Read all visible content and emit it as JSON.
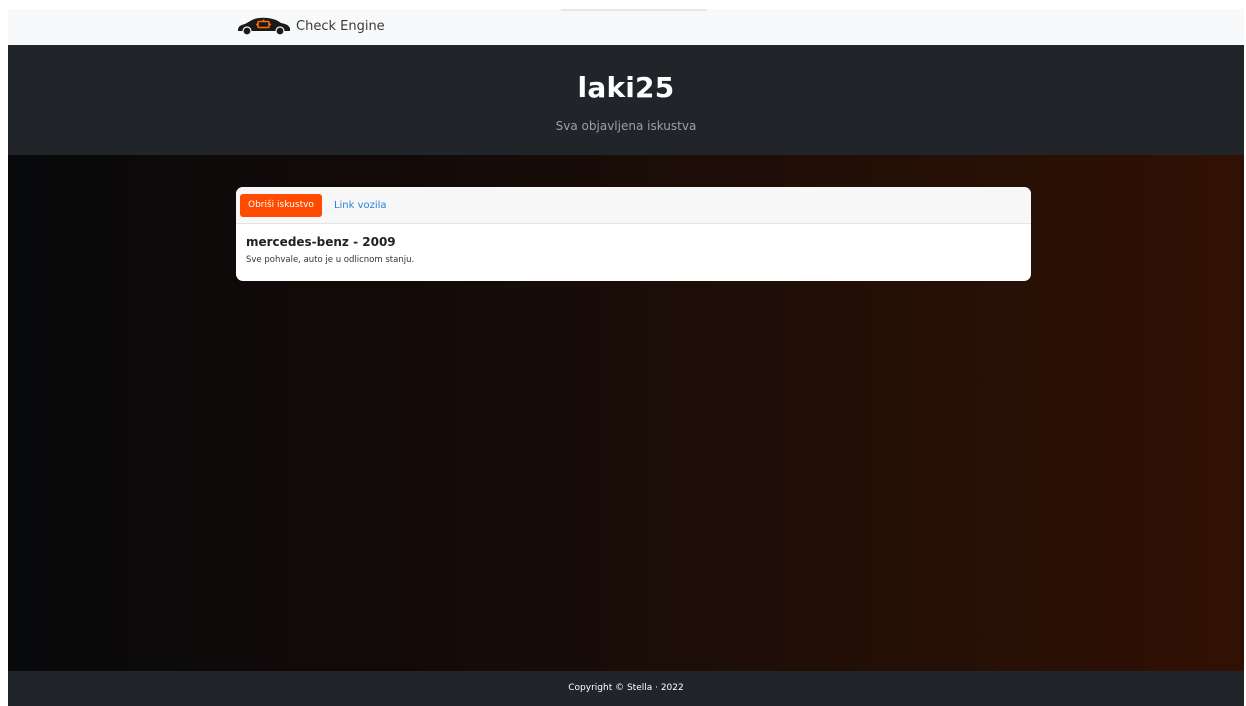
{
  "navbar": {
    "brand_icon": "car-check-engine-icon",
    "brand_text": "Check Engine"
  },
  "header": {
    "title": "laki25",
    "subtitle": "Sva objavljena iskustva"
  },
  "experiences": [
    {
      "delete_label": "Obriši iskustvo",
      "link_label": "Link vozila",
      "title": "mercedes-benz - 2009",
      "text": "Sve pohvale, auto je u odlicnom stanju."
    }
  ],
  "footer": {
    "text": "Copyright © Stella · 2022"
  },
  "colors": {
    "accent": "#ff4b00",
    "link": "#2a7fd8",
    "dark": "#212529",
    "navbar_bg": "#f8f9fa"
  }
}
